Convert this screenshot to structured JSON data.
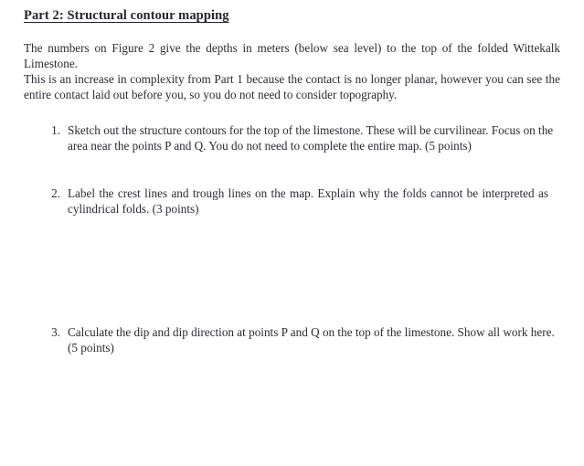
{
  "document": {
    "heading": "Part 2: Structural contour mapping",
    "intro": {
      "paragraph_1": "The numbers on Figure 2 give the depths in meters (below sea level) to the top of the folded Wittekalk Limestone.",
      "paragraph_2": "This is an increase in complexity from Part 1 because the contact is no longer planar, however you can see the entire contact laid out before you, so you do not need to consider topography."
    },
    "questions": [
      {
        "number": "1.",
        "text": "Sketch out the structure contours for the top of the limestone. These will be curvilinear. Focus on the area near the points P and Q. You do not need to complete the entire map. (5 points)",
        "points": "5 points"
      },
      {
        "number": "2.",
        "text": "Label the crest lines and trough lines on the map. Explain why the folds cannot be interpreted as cylindrical folds. (3 points)",
        "points": "3 points"
      },
      {
        "number": "3.",
        "text": "Calculate the dip and dip direction at points P and Q on the top of the limestone. Show all work here. (5 points)",
        "points": "5 points"
      }
    ],
    "colors": {
      "page_background": "#ffffff",
      "body_text": "#2b2b33",
      "heading_text": "#25252e"
    }
  }
}
